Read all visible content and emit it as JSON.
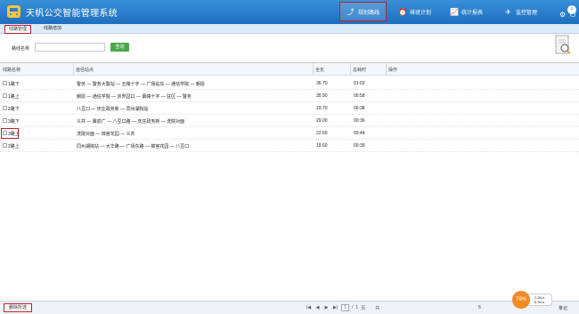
{
  "app": {
    "title": "天帆公交智能管理系统"
  },
  "nav": [
    {
      "label": "规划路线",
      "icon": "route-icon"
    },
    {
      "label": "排班计划",
      "icon": "clock-icon"
    },
    {
      "label": "统计报表",
      "icon": "chart-icon"
    },
    {
      "label": "监控管理",
      "icon": "send-icon"
    }
  ],
  "subtabs": [
    "线路管理",
    "线路增加"
  ],
  "search": {
    "label": "路线名称",
    "value": "",
    "placeholder": "",
    "button": "查询"
  },
  "table": {
    "columns": [
      "线路名称",
      "途径站点",
      "全长",
      "总耗时",
      "操作"
    ],
    "rows": [
      {
        "name": "1路下",
        "stops": "警务 — 警务大警站 — 五幢十字 — 广场站东 — 通信学院 — 朝恩",
        "length": "36.70",
        "time": "01:02"
      },
      {
        "name": "1路上",
        "stops": "朝恩 — 通信学院 — 京界园口 — 幕幢十字 — 驻区 — 警务",
        "length": "35.90",
        "time": "00:58"
      },
      {
        "name": "2路下",
        "stops": "八豆口 — 庆庄政务新 — 同州湖院站",
        "length": "19.70",
        "time": "00:38"
      },
      {
        "name": "3路下",
        "stops": "义井 — 骤前广 — 八豆口路 — 庆庄政务新 — 洗院对面",
        "length": "29.00",
        "time": "00:36"
      },
      {
        "name": "3路上",
        "stops": "洗院对面 — 锦宫花园 — 义井",
        "length": "22.60",
        "time": "00:44"
      },
      {
        "name": "2路上",
        "stops": "同州湖院站 — 大华路 — 广场东路 — 锦宫花园 — 八豆口",
        "length": "19.60",
        "time": "00:39"
      }
    ]
  },
  "footer": {
    "delete_button": "删除所选",
    "page_current": "1",
    "page_total_prefix": "/",
    "page_total": "1",
    "page_suffix": "页",
    "total_prefix": "共",
    "total_count": "6",
    "total_label": "条记"
  },
  "speed": {
    "percent": "79%",
    "up": "2.2K/s",
    "down": "8.9K/s"
  }
}
